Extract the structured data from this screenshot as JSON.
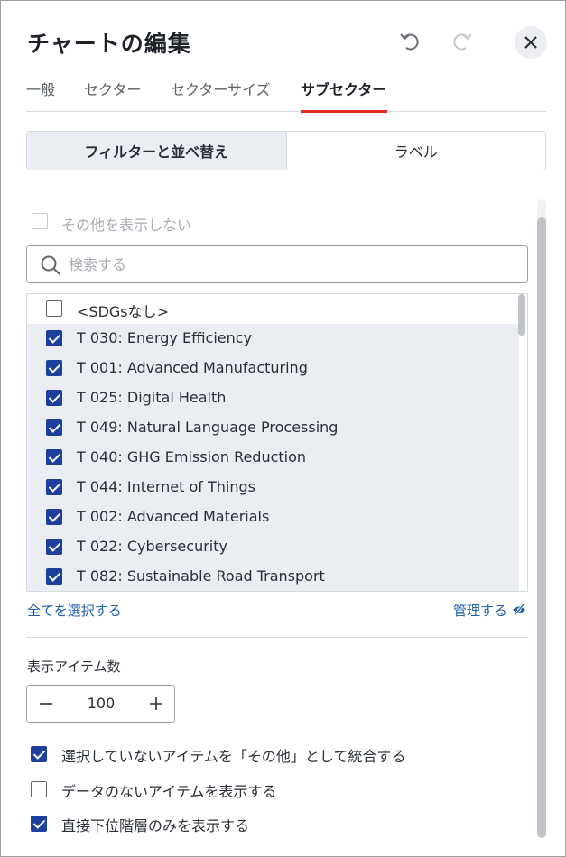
{
  "header": {
    "title": "チャートの編集",
    "undo_icon": "undo-icon",
    "redo_icon": "redo-icon",
    "close_icon": "close-icon"
  },
  "tabs": [
    {
      "label": "一般",
      "active": false
    },
    {
      "label": "セクター",
      "active": false
    },
    {
      "label": "セクターサイズ",
      "active": false
    },
    {
      "label": "サブセクター",
      "active": true
    }
  ],
  "segments": [
    {
      "label": "フィルターと並べ替え",
      "active": true
    },
    {
      "label": "ラベル",
      "active": false
    }
  ],
  "hide_other": {
    "label": "その他を表示しない",
    "checked": false,
    "disabled": true
  },
  "search": {
    "placeholder": "検索する",
    "value": ""
  },
  "items": [
    {
      "label": "<SDGsなし>",
      "checked": false
    },
    {
      "label": "T 030: Energy Efficiency",
      "checked": true
    },
    {
      "label": "T 001: Advanced Manufacturing",
      "checked": true
    },
    {
      "label": "T 025: Digital Health",
      "checked": true
    },
    {
      "label": "T 049: Natural Language Processing",
      "checked": true
    },
    {
      "label": "T 040: GHG Emission Reduction",
      "checked": true
    },
    {
      "label": "T 044: Internet of Things",
      "checked": true
    },
    {
      "label": "T 002: Advanced Materials",
      "checked": true
    },
    {
      "label": "T 022: Cybersecurity",
      "checked": true
    },
    {
      "label": "T 082: Sustainable Road Transport",
      "checked": true
    }
  ],
  "links": {
    "select_all": "全てを選択する",
    "manage": "管理する"
  },
  "item_count": {
    "title": "表示アイテム数",
    "value": "100"
  },
  "options": [
    {
      "label": "選択していないアイテムを「その他」として統合する",
      "checked": true
    },
    {
      "label": "データのないアイテムを表示する",
      "checked": false
    },
    {
      "label": "直接下位階層のみを表示する",
      "checked": true
    }
  ],
  "colors": {
    "accent": "#e02b20",
    "checkbox": "#1d3f9e",
    "link": "#1d5fa8"
  }
}
